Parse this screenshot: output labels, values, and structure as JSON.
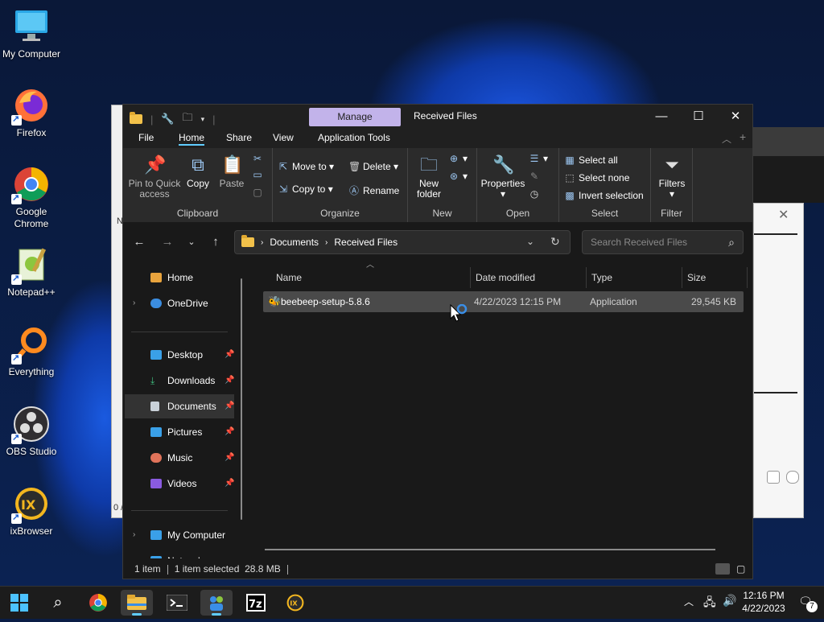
{
  "desktop": {
    "icons": [
      {
        "label": "My Computer",
        "icon": "monitor-icon"
      },
      {
        "label": "Firefox",
        "icon": "firefox-icon"
      },
      {
        "label": "Google Chrome",
        "icon": "chrome-icon"
      },
      {
        "label": "Notepad++",
        "icon": "notepadpp-icon"
      },
      {
        "label": "Everything",
        "icon": "everything-icon"
      },
      {
        "label": "OBS Studio",
        "icon": "obs-icon"
      },
      {
        "label": "ixBrowser",
        "icon": "ixbrowser-icon"
      }
    ]
  },
  "window": {
    "title": "Received Files",
    "manage_tab": "Manage",
    "menu_tabs": [
      "File",
      "Home",
      "Share",
      "View",
      "Application Tools"
    ],
    "active_tab": "Home"
  },
  "ribbon": {
    "clipboard": {
      "name": "Clipboard",
      "pin_label": "Pin to Quick access",
      "copy_label": "Copy",
      "paste_label": "Paste"
    },
    "organize": {
      "name": "Organize",
      "move_to": "Move to",
      "copy_to": "Copy to",
      "delete": "Delete",
      "rename": "Rename"
    },
    "new": {
      "name": "New",
      "new_folder": "New folder"
    },
    "open": {
      "name": "Open",
      "properties": "Properties"
    },
    "select": {
      "name": "Select",
      "select_all": "Select all",
      "select_none": "Select none",
      "invert": "Invert selection"
    },
    "filter": {
      "name": "Filter",
      "filters": "Filters"
    }
  },
  "address": {
    "crumbs": [
      "Documents",
      "Received Files"
    ],
    "search_placeholder": "Search Received Files"
  },
  "nav_pane": {
    "items": [
      {
        "label": "Home",
        "color": "#e8a33d"
      },
      {
        "label": "OneDrive",
        "color": "#3b8de0"
      },
      {
        "label": "Desktop",
        "color": "#3aa0e8"
      },
      {
        "label": "Downloads",
        "color": "#3fbf7f"
      },
      {
        "label": "Documents",
        "color": "#c9d1d9"
      },
      {
        "label": "Pictures",
        "color": "#3aa0e8"
      },
      {
        "label": "Music",
        "color": "#e0735a"
      },
      {
        "label": "Videos",
        "color": "#8a5be0"
      },
      {
        "label": "My Computer",
        "color": "#3aa0e8"
      },
      {
        "label": "Network",
        "color": "#3aa0e8"
      }
    ]
  },
  "columns": [
    "Name",
    "Date modified",
    "Type",
    "Size"
  ],
  "files": [
    {
      "name": "beebeep-setup-5.8.6",
      "date": "4/22/2023 12:15 PM",
      "type": "Application",
      "size": "29,545 KB"
    }
  ],
  "status": {
    "count": "1 item",
    "selected": "1 item selected",
    "size": "28.8 MB"
  },
  "taskbar": {
    "time": "12:16 PM",
    "date": "4/22/2023",
    "notifications": "7"
  },
  "behind_window": {
    "letters": [
      "N",
      "0 /"
    ]
  }
}
